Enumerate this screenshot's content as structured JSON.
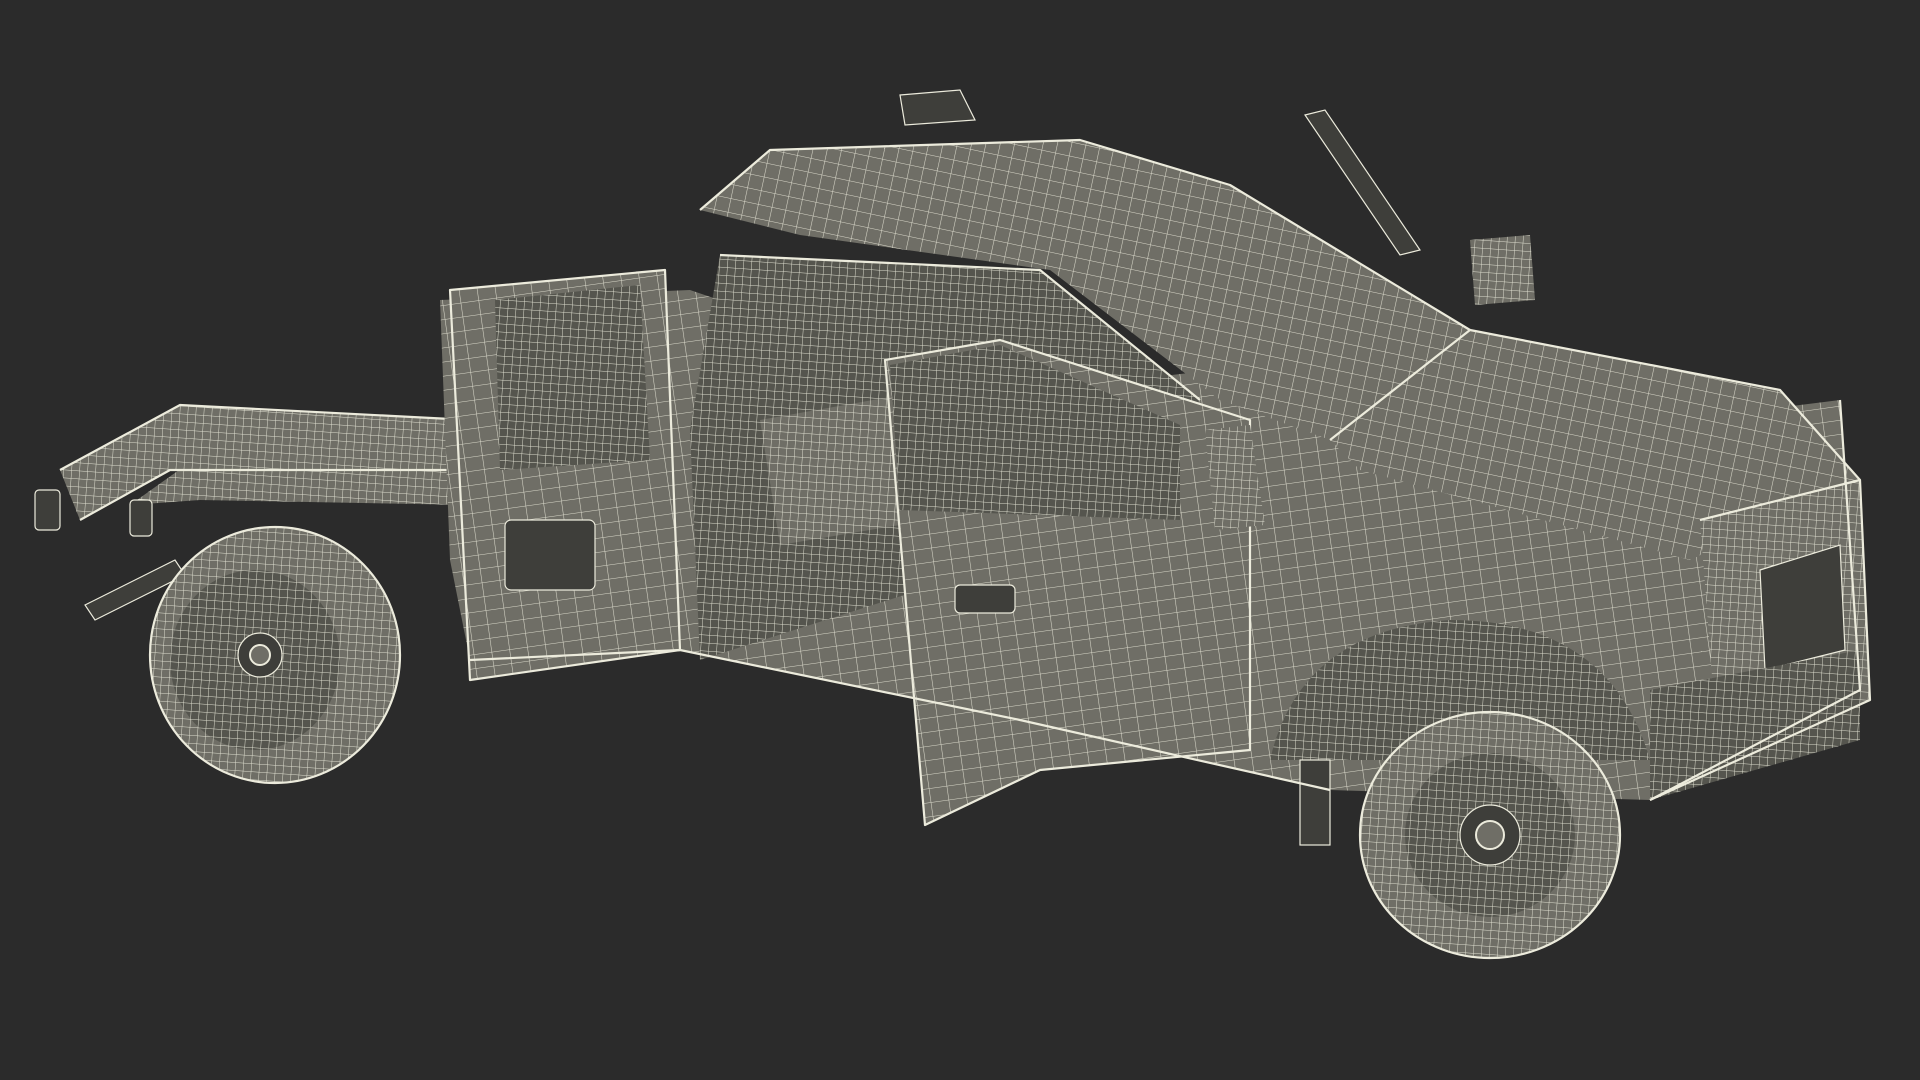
{
  "scene": {
    "subject": "pickup-truck-chassis-cab-wireframe",
    "colors": {
      "background": "#2b2b2b",
      "surface": "#6f6e66",
      "surface_shadow": "#55554e",
      "wire": "#ecebdc",
      "dark_part": "#3e3e3a"
    },
    "render_mode": "wireframe"
  }
}
